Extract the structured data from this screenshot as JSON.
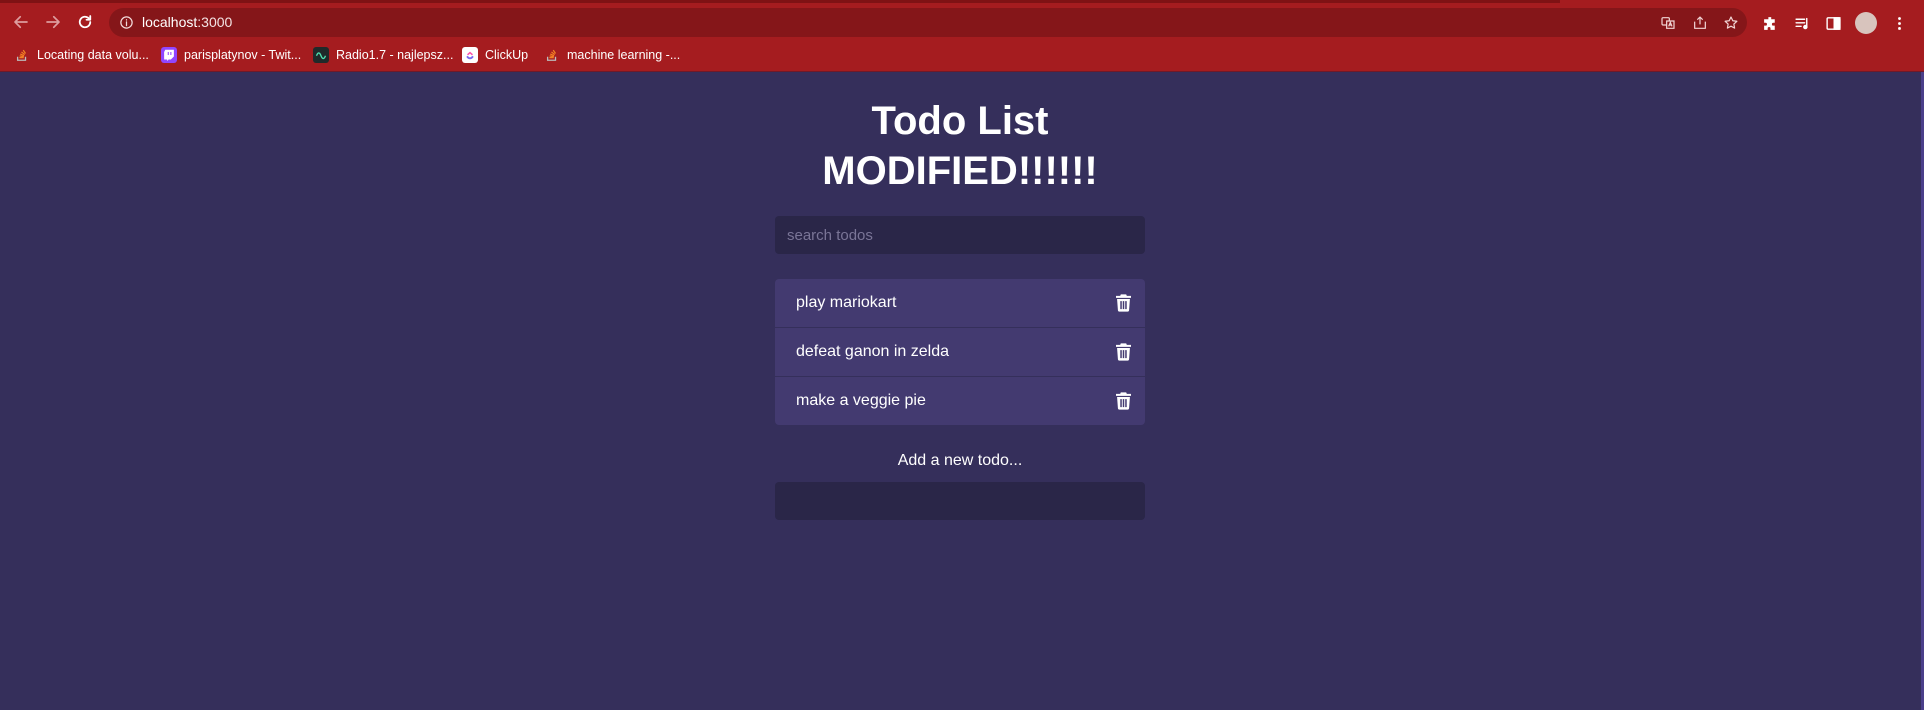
{
  "browser": {
    "url_host": "localhost",
    "url_port": ":3000",
    "bookmarks": [
      {
        "label": "Locating data volu...",
        "icon": "stackoverflow-icon"
      },
      {
        "label": "parisplatynov - Twit...",
        "icon": "twitch-icon"
      },
      {
        "label": "Radio1.7 - najlepsz...",
        "icon": "radio-icon"
      },
      {
        "label": "ClickUp",
        "icon": "clickup-icon"
      },
      {
        "label": "machine learning -...",
        "icon": "stackoverflow-icon"
      }
    ],
    "colors": {
      "frame": "#a51c1f",
      "omnibox": "#851619"
    }
  },
  "app": {
    "title_line1": "Todo List",
    "title_line2": "MODIFIED!!!!!!",
    "search_placeholder": "search todos",
    "todos": [
      {
        "text": "play mariokart"
      },
      {
        "text": "defeat ganon in zelda"
      },
      {
        "text": "make a veggie pie"
      }
    ],
    "add_label": "Add a new todo...",
    "add_value": "",
    "colors": {
      "background": "#352f5b",
      "item": "#433a70",
      "input": "#2a2648"
    }
  }
}
